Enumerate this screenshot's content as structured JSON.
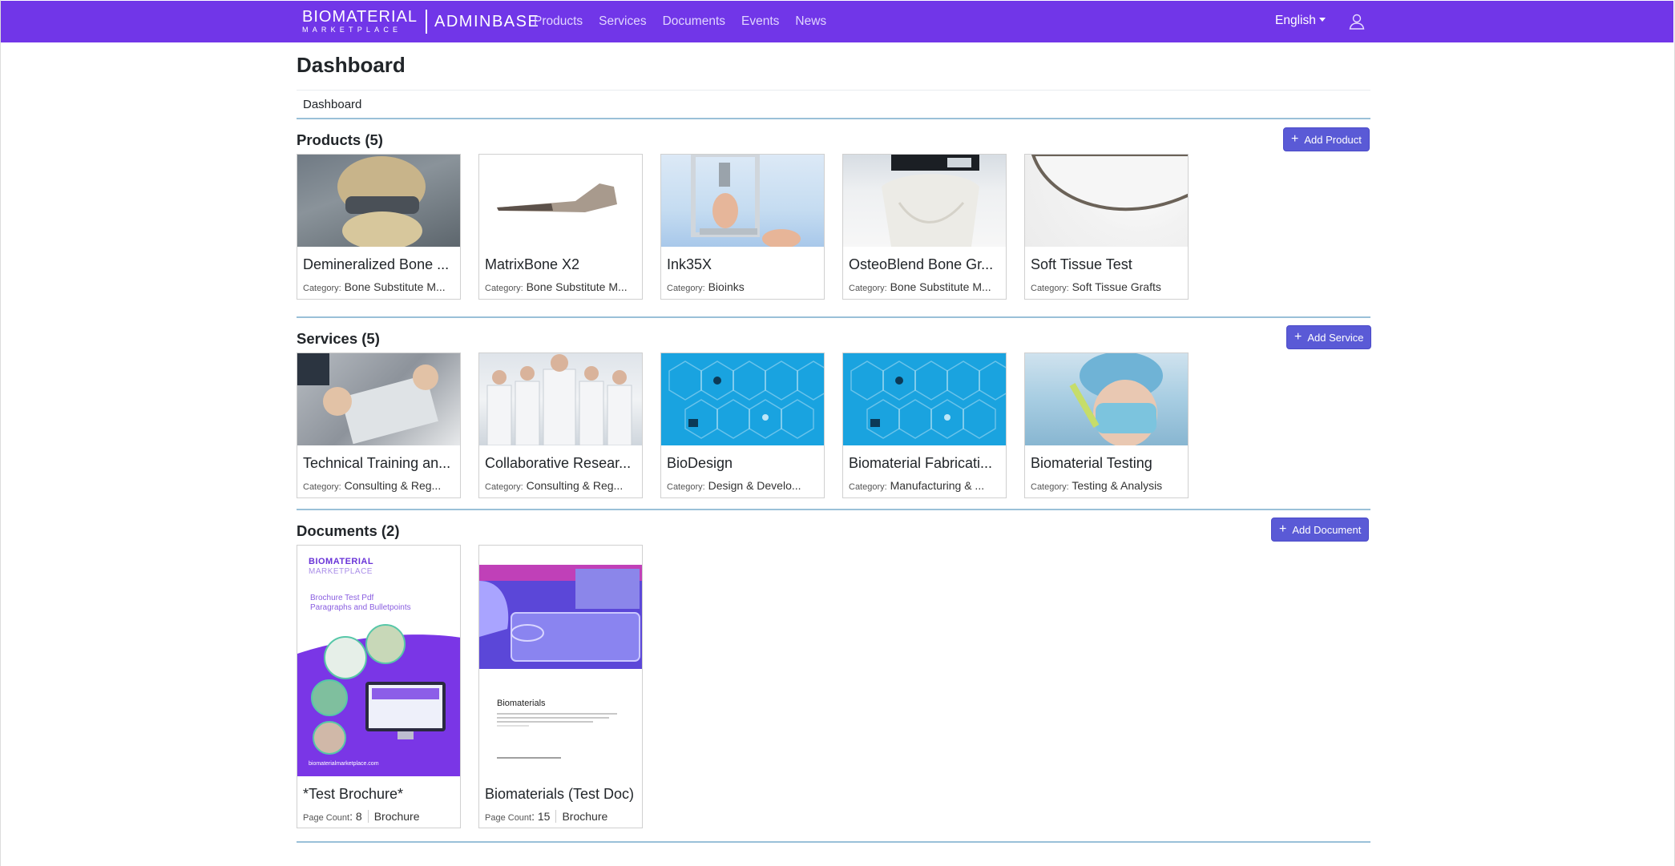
{
  "navbar": {
    "brand_line1": "BIOMATERIAL",
    "brand_line2": "MARKETPLACE",
    "brand_admin": "ADMINBASE",
    "links": [
      "Products",
      "Services",
      "Documents",
      "Events",
      "News"
    ],
    "language": "English"
  },
  "page": {
    "title": "Dashboard",
    "breadcrumb": "Dashboard"
  },
  "products": {
    "title": "Products (5)",
    "add_label": "Add Product",
    "category_key": "Category:",
    "items": [
      {
        "name": "Demineralized Bone ...",
        "category": "Bone Substitute M..."
      },
      {
        "name": "MatrixBone X2",
        "category": "Bone Substitute M..."
      },
      {
        "name": "Ink35X",
        "category": "Bioinks"
      },
      {
        "name": "OsteoBlend Bone Gr...",
        "category": "Bone Substitute M..."
      },
      {
        "name": "Soft Tissue Test",
        "category": "Soft Tissue Grafts"
      }
    ]
  },
  "services": {
    "title": "Services (5)",
    "add_label": "Add Service",
    "category_key": "Category:",
    "items": [
      {
        "name": "Technical Training an...",
        "category": "Consulting & Reg..."
      },
      {
        "name": "Collaborative Resear...",
        "category": "Consulting & Reg..."
      },
      {
        "name": "BioDesign",
        "category": "Design & Develo..."
      },
      {
        "name": "Biomaterial Fabricati...",
        "category": "Manufacturing & ..."
      },
      {
        "name": "Biomaterial Testing",
        "category": "Testing & Analysis"
      }
    ]
  },
  "documents": {
    "title": "Documents (2)",
    "add_label": "Add Document",
    "page_count_key": "Page Count",
    "items": [
      {
        "name": "*Test Brochure*",
        "page_count": "8",
        "type": "Brochure",
        "cover_brand1": "BIOMATERIAL",
        "cover_brand2": "MARKETPLACE",
        "cover_line1": "Brochure Test Pdf",
        "cover_line2": "Paragraphs and Bulletpoints",
        "cover_footer": "biomaterialmarketplace.com"
      },
      {
        "name": "Biomaterials (Test Doc)",
        "page_count": "15",
        "type": "Brochure",
        "cover_title": "Biomaterials"
      }
    ]
  }
}
